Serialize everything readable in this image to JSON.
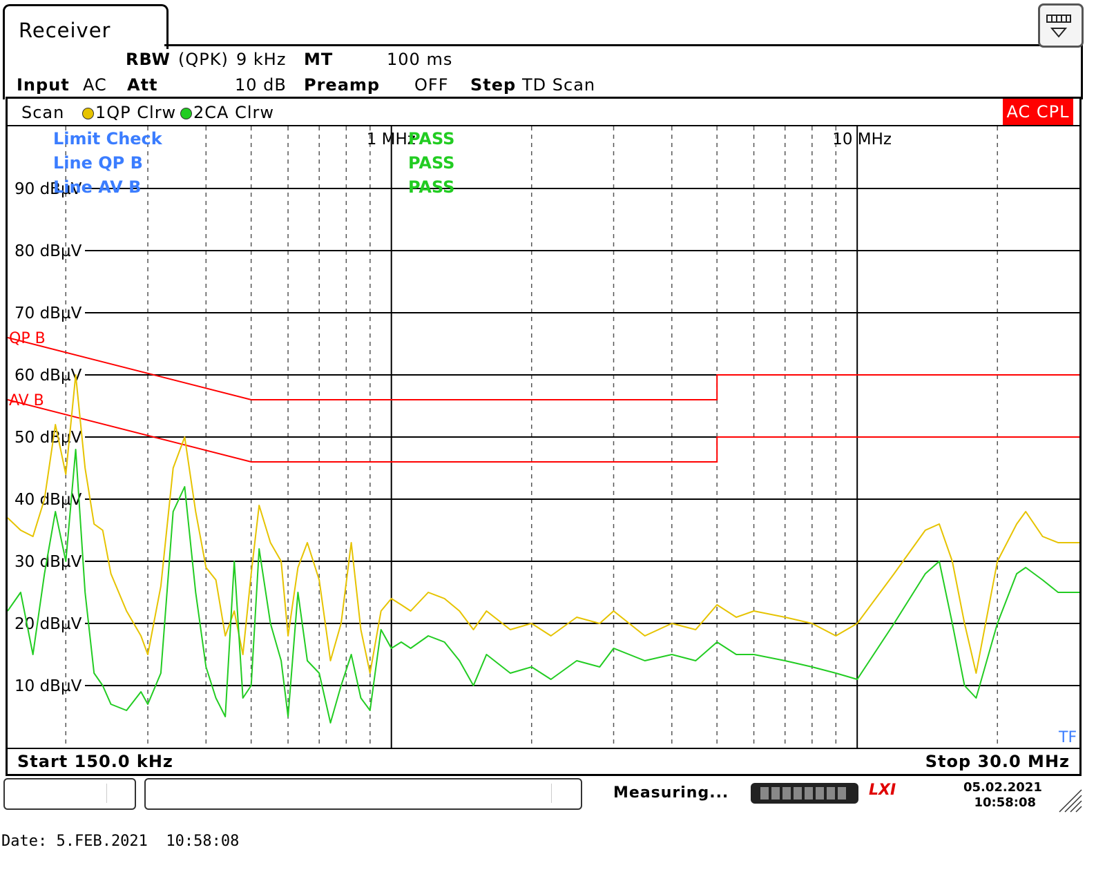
{
  "header": {
    "tab_title": "Receiver",
    "rbw_label": "RBW",
    "rbw_detector": "(QPK)",
    "rbw_value": "9 kHz",
    "mt_label": "MT",
    "mt_value": "100 ms",
    "input_label": "Input",
    "input_value": "AC",
    "att_label": "Att",
    "att_value": "10 dB",
    "preamp_label": "Preamp",
    "preamp_value": "OFF",
    "step_label": "Step",
    "step_value": "TD Scan"
  },
  "scanbar": {
    "scan_label": "Scan",
    "trace1_label": "1QP Clrw",
    "trace2_label": "2CA Clrw",
    "coupling_badge": "AC CPL",
    "trace1_color": "#e6c300",
    "trace2_color": "#22cc22",
    "coupling_color": "#ff0000"
  },
  "limit_check": {
    "title": "Limit Check",
    "title_result": "PASS",
    "line1_name": "Line QP B",
    "line1_result": "PASS",
    "line2_name": "Line AV B",
    "line2_result": "PASS",
    "label_color": "#3b7dff",
    "pass_color": "#22cc22"
  },
  "footer": {
    "start": "Start 150.0 kHz",
    "stop": "Stop 30.0 MHz"
  },
  "statusbar": {
    "measuring": "Measuring...",
    "logo": "LXI",
    "date": "05.02.2021",
    "time": "10:58:08"
  },
  "capture_line": "Date: 5.FEB.2021  10:58:08",
  "chart_data": {
    "type": "line",
    "xscale": "log",
    "xlim_hz": [
      150000,
      30000000
    ],
    "ylim": [
      0,
      100
    ],
    "yunit": "dBµV",
    "yticks": [
      10,
      20,
      30,
      40,
      50,
      60,
      70,
      80,
      90
    ],
    "ytick_labels": [
      "10 dBµV",
      "20 dBµV",
      "30 dBµV",
      "40 dBµV",
      "50 dBµV",
      "60 dBµV",
      "70 dBµV",
      "80 dBµV",
      "90 dBµV"
    ],
    "xtick_labels": [
      {
        "hz": 1000000,
        "label": "1 MHz"
      },
      {
        "hz": 10000000,
        "label": "10 MHz"
      }
    ],
    "grid": true,
    "corner_label": "TF",
    "limit_lines": [
      {
        "name": "QP B",
        "color": "#ff0000",
        "x_hz": [
          150000,
          500000,
          500000,
          5000000,
          5000000,
          30000000
        ],
        "y": [
          66,
          56,
          56,
          56,
          60,
          60
        ]
      },
      {
        "name": "AV B",
        "color": "#ff0000",
        "x_hz": [
          150000,
          500000,
          500000,
          5000000,
          5000000,
          30000000
        ],
        "y": [
          56,
          46,
          46,
          46,
          50,
          50
        ]
      }
    ],
    "series": [
      {
        "name": "1QP Clrw",
        "color": "#e6c300",
        "x_mhz": [
          0.15,
          0.16,
          0.17,
          0.18,
          0.19,
          0.2,
          0.21,
          0.22,
          0.23,
          0.24,
          0.25,
          0.27,
          0.29,
          0.3,
          0.32,
          0.34,
          0.36,
          0.38,
          0.4,
          0.42,
          0.44,
          0.46,
          0.48,
          0.5,
          0.52,
          0.55,
          0.58,
          0.6,
          0.63,
          0.66,
          0.7,
          0.74,
          0.78,
          0.82,
          0.86,
          0.9,
          0.95,
          1.0,
          1.05,
          1.1,
          1.2,
          1.3,
          1.4,
          1.5,
          1.6,
          1.8,
          2.0,
          2.2,
          2.5,
          2.8,
          3.0,
          3.5,
          4.0,
          4.5,
          5.0,
          5.5,
          6.0,
          7.0,
          8.0,
          9.0,
          10.0,
          12.0,
          14.0,
          15.0,
          16.0,
          17.0,
          18.0,
          20.0,
          22.0,
          23.0,
          25.0,
          27.0,
          30.0
        ],
        "y": [
          37,
          35,
          34,
          40,
          52,
          44,
          60,
          45,
          36,
          35,
          28,
          22,
          18,
          15,
          26,
          45,
          50,
          38,
          29,
          27,
          18,
          22,
          15,
          28,
          39,
          33,
          30,
          18,
          29,
          33,
          27,
          14,
          20,
          33,
          19,
          12,
          22,
          24,
          23,
          22,
          25,
          24,
          22,
          19,
          22,
          19,
          20,
          18,
          21,
          20,
          22,
          18,
          20,
          19,
          23,
          21,
          22,
          21,
          20,
          18,
          20,
          28,
          35,
          36,
          30,
          20,
          12,
          30,
          36,
          38,
          34,
          33,
          33
        ]
      },
      {
        "name": "2CA Clrw",
        "color": "#22cc22",
        "x_mhz": [
          0.15,
          0.16,
          0.17,
          0.18,
          0.19,
          0.2,
          0.21,
          0.22,
          0.23,
          0.24,
          0.25,
          0.27,
          0.29,
          0.3,
          0.32,
          0.34,
          0.36,
          0.38,
          0.4,
          0.42,
          0.44,
          0.46,
          0.48,
          0.5,
          0.52,
          0.55,
          0.58,
          0.6,
          0.63,
          0.66,
          0.7,
          0.74,
          0.78,
          0.82,
          0.86,
          0.9,
          0.95,
          1.0,
          1.05,
          1.1,
          1.2,
          1.3,
          1.4,
          1.5,
          1.6,
          1.8,
          2.0,
          2.2,
          2.5,
          2.8,
          3.0,
          3.5,
          4.0,
          4.5,
          5.0,
          5.5,
          6.0,
          7.0,
          8.0,
          9.0,
          10.0,
          12.0,
          14.0,
          15.0,
          16.0,
          17.0,
          18.0,
          20.0,
          22.0,
          23.0,
          25.0,
          27.0,
          30.0
        ],
        "y": [
          22,
          25,
          15,
          28,
          38,
          30,
          48,
          25,
          12,
          10,
          7,
          6,
          9,
          7,
          12,
          38,
          42,
          25,
          13,
          8,
          5,
          30,
          8,
          10,
          32,
          20,
          14,
          5,
          25,
          14,
          12,
          4,
          10,
          15,
          8,
          6,
          19,
          16,
          17,
          16,
          18,
          17,
          14,
          10,
          15,
          12,
          13,
          11,
          14,
          13,
          16,
          14,
          15,
          14,
          17,
          15,
          15,
          14,
          13,
          12,
          11,
          20,
          28,
          30,
          20,
          10,
          8,
          20,
          28,
          29,
          27,
          25,
          25
        ]
      }
    ]
  }
}
